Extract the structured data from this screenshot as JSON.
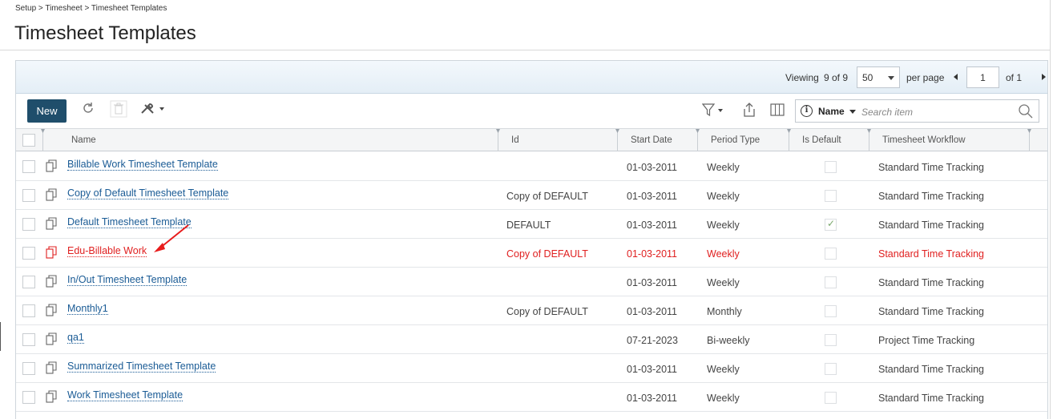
{
  "breadcrumb": "Setup > Timesheet > Timesheet Templates",
  "page_title": "Timesheet Templates",
  "pager": {
    "viewing_label": "Viewing",
    "viewing_value": "9 of 9",
    "per_page_value": "50",
    "per_page_label": "per page",
    "page_value": "1",
    "of_label": "of 1"
  },
  "toolbar": {
    "new_label": "New",
    "search_field": "Name",
    "search_placeholder": "Search item"
  },
  "columns": [
    "Name",
    "Id",
    "Start Date",
    "Period Type",
    "Is Default",
    "Timesheet Workflow"
  ],
  "rows": [
    {
      "name": "Billable Work Timesheet Template",
      "id": "",
      "start": "01-03-2011",
      "period": "Weekly",
      "is_default": false,
      "workflow": "Standard Time Tracking",
      "highlight": false
    },
    {
      "name": "Copy of Default Timesheet Template",
      "id": "Copy of DEFAULT",
      "start": "01-03-2011",
      "period": "Weekly",
      "is_default": false,
      "workflow": "Standard Time Tracking",
      "highlight": false
    },
    {
      "name": "Default Timesheet Template",
      "id": "DEFAULT",
      "start": "01-03-2011",
      "period": "Weekly",
      "is_default": true,
      "workflow": "Standard Time Tracking",
      "highlight": false
    },
    {
      "name": "Edu-Billable Work",
      "id": "Copy of DEFAULT",
      "start": "01-03-2011",
      "period": "Weekly",
      "is_default": false,
      "workflow": "Standard Time Tracking",
      "highlight": true
    },
    {
      "name": "In/Out Timesheet Template",
      "id": "",
      "start": "01-03-2011",
      "period": "Weekly",
      "is_default": false,
      "workflow": "Standard Time Tracking",
      "highlight": false
    },
    {
      "name": "Monthly1",
      "id": "Copy of DEFAULT",
      "start": "01-03-2011",
      "period": "Monthly",
      "is_default": false,
      "workflow": "Standard Time Tracking",
      "highlight": false
    },
    {
      "name": "qa1",
      "id": "",
      "start": "07-21-2023",
      "period": "Bi-weekly",
      "is_default": false,
      "workflow": "Project Time Tracking",
      "highlight": false
    },
    {
      "name": "Summarized Timesheet Template",
      "id": "",
      "start": "01-03-2011",
      "period": "Weekly",
      "is_default": false,
      "workflow": "Standard Time Tracking",
      "highlight": false
    },
    {
      "name": "Work Timesheet Template",
      "id": "",
      "start": "01-03-2011",
      "period": "Weekly",
      "is_default": false,
      "workflow": "Standard Time Tracking",
      "highlight": false
    }
  ],
  "colors": {
    "accent": "#1f4e6b",
    "link": "#1a5b95",
    "highlight": "#e02020"
  }
}
